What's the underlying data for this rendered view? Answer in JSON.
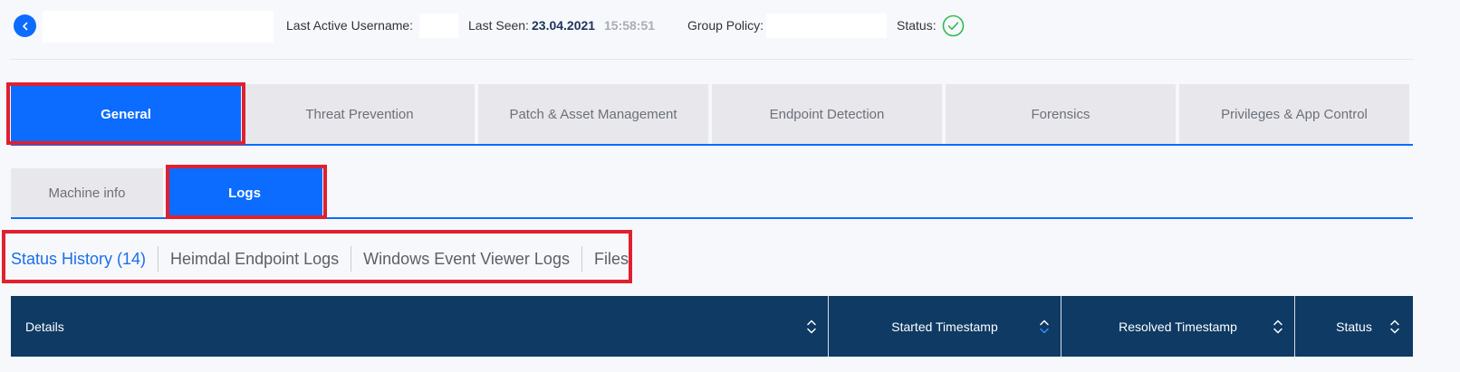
{
  "header": {
    "last_active_label": "Last Active Username:",
    "last_seen_label": "Last Seen:",
    "last_seen_date": "23.04.2021",
    "last_seen_time": "15:58:51",
    "group_policy_label": "Group Policy:",
    "status_label": "Status:"
  },
  "main_tabs": [
    {
      "label": "General",
      "active": true
    },
    {
      "label": "Threat Prevention"
    },
    {
      "label": "Patch & Asset Management"
    },
    {
      "label": "Endpoint Detection"
    },
    {
      "label": "Forensics"
    },
    {
      "label": "Privileges & App Control"
    }
  ],
  "sub_tabs": [
    {
      "label": "Machine info"
    },
    {
      "label": "Logs",
      "active": true
    }
  ],
  "log_tabs": [
    {
      "label": "Status History (14)",
      "active": true
    },
    {
      "label": "Heimdal Endpoint Logs"
    },
    {
      "label": "Windows Event Viewer Logs"
    },
    {
      "label": "Files"
    }
  ],
  "table": {
    "columns": [
      {
        "label": "Details"
      },
      {
        "label": "Started Timestamp"
      },
      {
        "label": "Resolved Timestamp"
      },
      {
        "label": "Status"
      }
    ]
  },
  "colors": {
    "accent": "#0b6cff",
    "highlight": "#e0202e",
    "table_header": "#0e3a64",
    "status_ok": "#2dbd4e"
  },
  "icons": {
    "back": "chevron-left-icon",
    "status": "check-circle-icon",
    "sort": "sort-icon"
  }
}
